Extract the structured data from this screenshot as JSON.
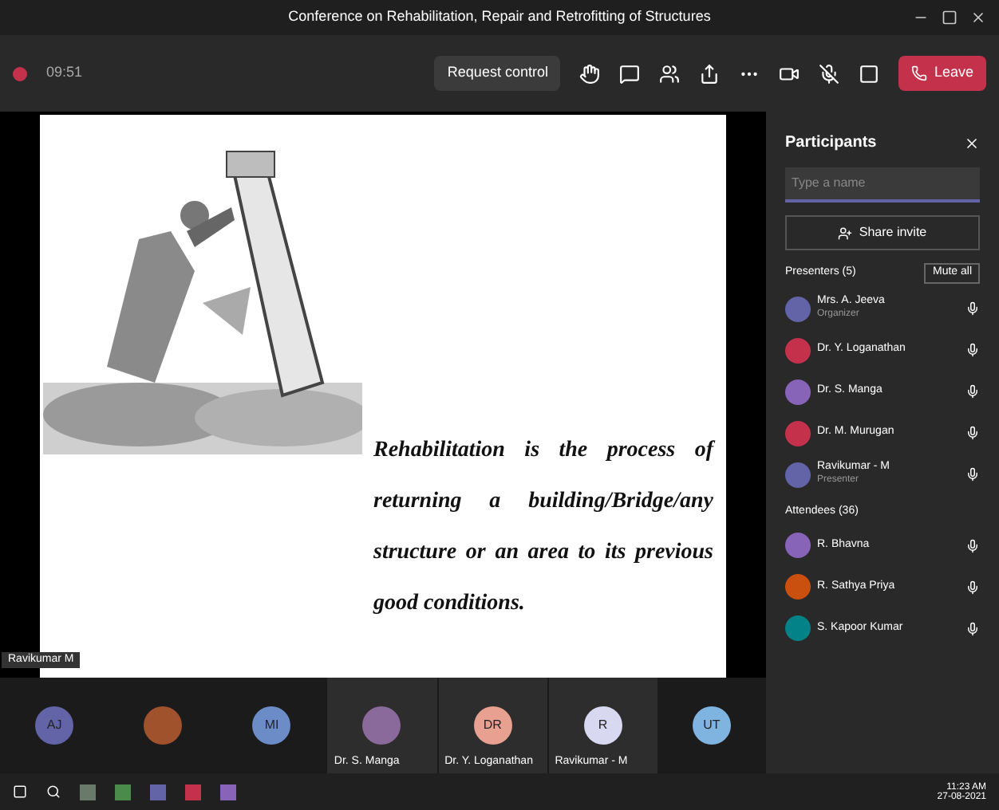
{
  "window": {
    "title": "Conference on Rehabilitation, Repair and Retrofitting of Structures"
  },
  "toolbar": {
    "timer": "09:51",
    "request_button": "Request control",
    "leave_button": "Leave"
  },
  "slide": {
    "text": "Rehabilitation is the process of returning a building/Bridge/any structure or an area to its previous good conditions.",
    "presenter_label": "Ravikumar M"
  },
  "participants": {
    "title": "Participants",
    "search": {
      "placeholder": "Type a name"
    },
    "share_button": "Share invite",
    "groups": [
      {
        "title": "Presenters (5)",
        "action": "Mute all",
        "members": [
          {
            "name": "Mrs. A. Jeeva",
            "role": "Organizer",
            "color": "#6264a7"
          },
          {
            "name": "Dr. Y. Loganathan",
            "color": "#c4314b"
          },
          {
            "name": "Dr. S. Manga",
            "color": "#8764b8"
          },
          {
            "name": "Dr. M. Murugan",
            "color": "#c4314b"
          },
          {
            "name": "Ravikumar - M",
            "role": "Presenter",
            "color": "#6264a7"
          }
        ]
      },
      {
        "title": "Attendees (36)",
        "members": [
          {
            "name": "R. Bhavna",
            "color": "#8764b8"
          },
          {
            "name": "R. Sathya Priya",
            "color": "#ca5010"
          },
          {
            "name": "S. Kapoor Kumar",
            "color": "#038387"
          }
        ]
      }
    ]
  },
  "tiles": [
    {
      "initials": "AJ",
      "color": "#6264a7"
    },
    {
      "color": "#a0522d"
    },
    {
      "initials": "MI",
      "color": "#6b8cc7"
    },
    {
      "name": "Dr. S. Manga",
      "color": "#8a6a9a"
    },
    {
      "name": "Dr. Y. Loganathan",
      "initials": "DR",
      "color": "#e8a090"
    },
    {
      "name": "Ravikumar - M",
      "initials": "R",
      "color": "#d8d8f0"
    },
    {
      "initials": "UT",
      "color": "#7fb3e0"
    }
  ],
  "taskbar": {
    "time": "11:23 AM",
    "date": "27-08-2021"
  }
}
